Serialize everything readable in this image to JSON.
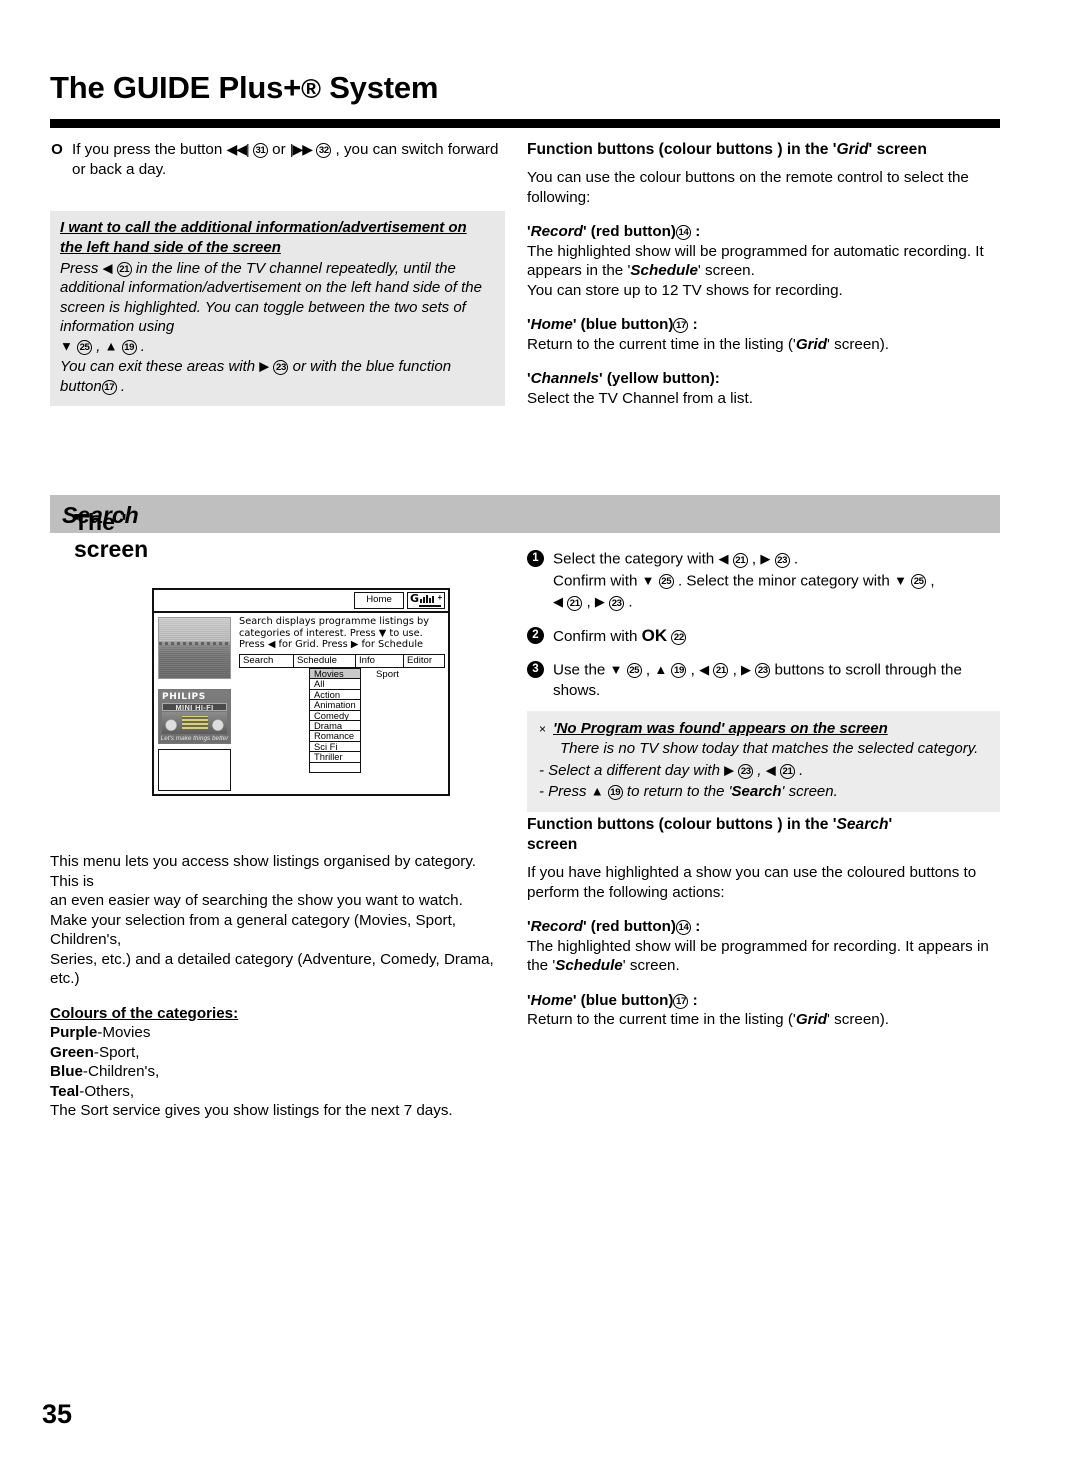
{
  "header": {
    "title_prefix": "The GUIDE Plus+",
    "title_reg": "®",
    "title_suffix": " System"
  },
  "left_column": {
    "bullet_marker": "O",
    "bullet_text_a": "If you press the button ",
    "bullet_skip_back": "◀◀|",
    "bullet_ref_31": "31",
    "bullet_text_b": " or ",
    "bullet_skip_fwd": "|▶▶",
    "bullet_ref_32": "32",
    "bullet_text_c": " , you can switch forward or back a day.",
    "info_box": {
      "heading_line1": "I want to call the additional information/advertisement on",
      "heading_line2": "the left hand side of the screen",
      "body_1a": "Press ",
      "ref_21": "21",
      "body_1b": " in the line of the TV channel repeatedly, until the additional information/advertisement on the left hand side of the screen is highlighted. You can toggle between the two sets of information using ",
      "ref_25": "25",
      "ref_19": "19",
      "body_1c": " .",
      "body_2a": "You can exit these areas with ",
      "ref_23": "23",
      "body_2b": " or with the blue function button",
      "ref_17": "17",
      "body_2c": " ."
    },
    "paragraph": {
      "line1": "This menu lets you access show listings organised by category. This is",
      "line2": "an even easier way of searching the show you want to watch.",
      "line3": "Make your selection from a general category (Movies, Sport, Children's,",
      "line4": "Series, etc.) and a detailed category (Adventure, Comedy, Drama, etc.)"
    },
    "colours": {
      "heading": "Colours of the categories:",
      "items": [
        {
          "colour": "Purple",
          "label": "-Movies"
        },
        {
          "colour": "Green",
          "label": "-Sport,"
        },
        {
          "colour": "Blue",
          "label": "-Children's,"
        },
        {
          "colour": "Teal",
          "label": "-Others,"
        }
      ],
      "footer": "The Sort service gives you show listings for the next 7 days."
    }
  },
  "band": {
    "prefix": "The '",
    "emph": "Search",
    "suffix": "' screen"
  },
  "right_column": {
    "grid_section": {
      "heading_a": "Function buttons (colour buttons ) in the '",
      "heading_emph": "Grid",
      "heading_b": "' screen",
      "intro": "You can use the colour buttons on the remote control to select the following:",
      "record_label_a": "'",
      "record_label_emph": "Record",
      "record_label_b": "' (red button)",
      "record_ref": "14",
      "record_colon": " :",
      "record_body_a": "The highlighted show will be programmed for automatic recording. It appears in the '",
      "record_body_emph": "Schedule",
      "record_body_b": "' screen.",
      "record_body_c": "You can store up to 12 TV shows for recording.",
      "home_label_a": "'",
      "home_label_emph": "Home",
      "home_label_b": "' (blue button)",
      "home_ref": "17",
      "home_colon": " :",
      "home_body_a": "Return to the current time in the listing ('",
      "home_body_emph": "Grid",
      "home_body_b": "' screen).",
      "channels_label_a": "'",
      "channels_label_emph": "Channels",
      "channels_label_b": "' (yellow button):",
      "channels_body": "Select the TV Channel from a list."
    },
    "steps": [
      {
        "num": "1",
        "a": "Select the category with ",
        "ref1": "21",
        "b": " , ",
        "ref2": "23",
        "c": " .",
        "d": "Confirm with ",
        "ref3": "25",
        "e": " . Select the minor category with ",
        "ref4": "25",
        "f": " ,",
        "ref5": "21",
        "g": " , ",
        "ref6": "23",
        "h": " ."
      },
      {
        "num": "2",
        "a": "Confirm with ",
        "ok": "OK",
        "ref1": "22"
      },
      {
        "num": "3",
        "a": "Use the ",
        "ref1": "25",
        "b": " , ",
        "ref2": "19",
        "c": " , ",
        "ref3": "21",
        "d": " , ",
        "ref4": "23",
        "e": " buttons to scroll through the shows."
      }
    ],
    "warning_box": {
      "mark": "×",
      "heading_a": "'",
      "heading_emph": "No Program was found",
      "heading_b": "' appears on the screen",
      "body": "There is no TV show today that matches the selected category.",
      "line2_a": "- Select a different day with ",
      "line2_ref1": "23",
      "line2_b": " , ",
      "line2_ref2": "21",
      "line2_c": " .",
      "line3_a": "- Press ",
      "line3_ref": "19",
      "line3_b": " to return to the '",
      "line3_emph": "Search",
      "line3_c": "' screen."
    },
    "search_section": {
      "heading_a": "Function buttons (colour buttons ) in the '",
      "heading_emph": "Search",
      "heading_b": "'",
      "heading_c": "screen",
      "intro": "If you have highlighted a show you can use the coloured buttons to perform the following actions:",
      "record_label_a": "'",
      "record_label_emph": "Record",
      "record_label_b": "' (red button)",
      "record_ref": "14",
      "record_colon": " :",
      "record_body_a": "The highlighted show will be programmed for recording. It appears in the '",
      "record_body_emph": "Schedule",
      "record_body_b": "' screen.",
      "home_label_a": "'",
      "home_label_emph": "Home",
      "home_label_b": "' (blue button)",
      "home_ref": "17",
      "home_colon": " :",
      "home_body_a": "Return to the current time in the listing ('",
      "home_body_emph": "Grid",
      "home_body_b": "' screen)."
    }
  },
  "tv_screen": {
    "home_button": "Home",
    "logo_letter": "G",
    "logo_plus": "+",
    "description": "Search displays programme listings by categories of interest. Press ▼ to use. Press ◀ for Grid. Press ▶ for Schedule",
    "tabs": [
      "Search",
      "Schedule",
      "Info",
      "Editor"
    ],
    "category_highlight": "Movies",
    "category_items": [
      "All",
      "Action",
      "Animation",
      "Comedy",
      "Drama",
      "Romance",
      "Sci Fi",
      "Thriller",
      ""
    ],
    "sport_label": "Sport",
    "ad": {
      "brand": "PHILIPS",
      "product": "MINI HI-FI",
      "slogan": "Let's make things better"
    }
  },
  "footer": {
    "page_number": "35"
  }
}
